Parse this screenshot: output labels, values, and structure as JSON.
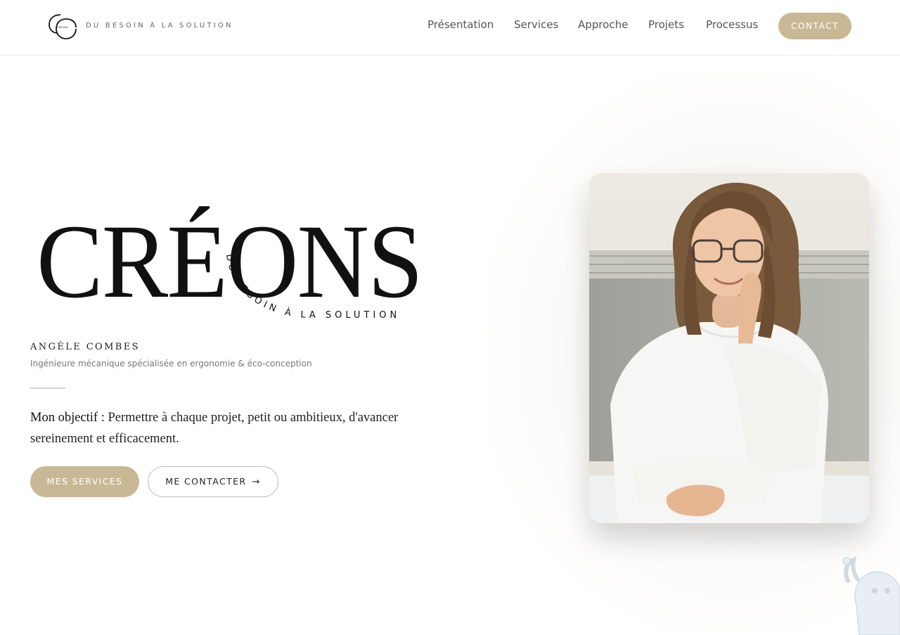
{
  "header": {
    "brand_name": "CRÉONS",
    "tagline": "DU BESOIN À LA SOLUTION",
    "nav": [
      {
        "label": "Présentation"
      },
      {
        "label": "Services"
      },
      {
        "label": "Approche"
      },
      {
        "label": "Projets"
      },
      {
        "label": "Processus"
      }
    ],
    "cta_label": "CONTACT"
  },
  "hero": {
    "wordmark": "CRÉONS",
    "wordmark_tagline": "DU BESOIN À LA SOLUTION",
    "name": "ANGÈLE COMBES",
    "role": "Ingénieure mécanique spécialisée en ergonomie & éco-conception",
    "objective_lead": "Mon objectif :",
    "objective_text": "Permettre à chaque projet, petit ou ambitieux, d'avancer sereinement et efficacement.",
    "primary_button": "MES SERVICES",
    "secondary_button": "ME CONTACTER",
    "photo_alt": "Portrait d'Angèle Combes"
  },
  "colors": {
    "accent": "#c9b896",
    "text": "#222222"
  }
}
